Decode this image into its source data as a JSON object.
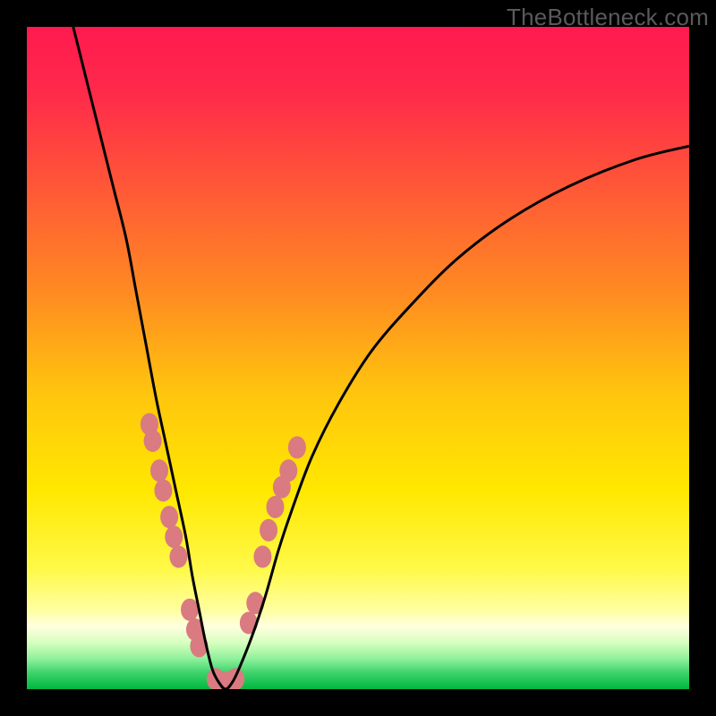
{
  "watermark": "TheBottleneck.com",
  "chart_data": {
    "type": "line",
    "title": "",
    "xlabel": "",
    "ylabel": "",
    "xlim": [
      0,
      100
    ],
    "ylim": [
      0,
      100
    ],
    "grid": false,
    "legend_position": "none",
    "background_gradient": {
      "stops": [
        {
          "offset": 0.0,
          "color": "#ff1a4f"
        },
        {
          "offset": 0.1,
          "color": "#ff2a4a"
        },
        {
          "offset": 0.25,
          "color": "#ff5a36"
        },
        {
          "offset": 0.4,
          "color": "#ff8a22"
        },
        {
          "offset": 0.55,
          "color": "#ffc40e"
        },
        {
          "offset": 0.7,
          "color": "#ffe800"
        },
        {
          "offset": 0.82,
          "color": "#fff94a"
        },
        {
          "offset": 0.88,
          "color": "#ffffa0"
        },
        {
          "offset": 0.905,
          "color": "#ffffe0"
        },
        {
          "offset": 0.93,
          "color": "#d6ffbe"
        },
        {
          "offset": 0.955,
          "color": "#8cf09a"
        },
        {
          "offset": 0.975,
          "color": "#3ed36b"
        },
        {
          "offset": 1.0,
          "color": "#00b840"
        }
      ]
    },
    "series": [
      {
        "name": "bottleneck-curve",
        "x": [
          7,
          9,
          11,
          13,
          15,
          16.5,
          18,
          19.5,
          21,
          22.5,
          24,
          25,
          26,
          27,
          28,
          29,
          30,
          31,
          32,
          34,
          36,
          38,
          40,
          43,
          47,
          52,
          58,
          65,
          73,
          82,
          92,
          100
        ],
        "y": [
          100,
          92,
          84,
          76,
          68,
          60,
          52,
          44,
          37,
          30,
          23,
          17,
          12,
          7,
          3,
          1,
          0,
          1,
          3,
          8,
          14,
          21,
          27,
          35,
          43,
          51,
          58,
          65,
          71,
          76,
          80,
          82
        ],
        "color": "#000000",
        "stroke_width": 2
      }
    ],
    "markers": [
      {
        "name": "left-cluster",
        "color": "#d97b80",
        "r": 10,
        "points": [
          {
            "x": 18.5,
            "y": 40
          },
          {
            "x": 19.0,
            "y": 37.5
          },
          {
            "x": 20.0,
            "y": 33
          },
          {
            "x": 20.6,
            "y": 30
          },
          {
            "x": 21.5,
            "y": 26
          },
          {
            "x": 22.2,
            "y": 23
          },
          {
            "x": 22.9,
            "y": 20
          },
          {
            "x": 24.6,
            "y": 12
          },
          {
            "x": 25.4,
            "y": 9
          },
          {
            "x": 26.0,
            "y": 6.5
          }
        ]
      },
      {
        "name": "valley-cluster",
        "color": "#d97b80",
        "r": 10,
        "points": [
          {
            "x": 28.5,
            "y": 1.5
          },
          {
            "x": 29.5,
            "y": 1.0
          },
          {
            "x": 30.5,
            "y": 1.0
          },
          {
            "x": 31.5,
            "y": 1.5
          }
        ]
      },
      {
        "name": "right-cluster",
        "color": "#d97b80",
        "r": 10,
        "points": [
          {
            "x": 33.5,
            "y": 10
          },
          {
            "x": 34.5,
            "y": 13
          },
          {
            "x": 35.6,
            "y": 20
          },
          {
            "x": 36.5,
            "y": 24
          },
          {
            "x": 37.5,
            "y": 27.5
          },
          {
            "x": 38.5,
            "y": 30.5
          },
          {
            "x": 39.5,
            "y": 33
          },
          {
            "x": 40.8,
            "y": 36.5
          }
        ]
      }
    ]
  },
  "colors": {
    "frame": "#000000",
    "curve": "#000000",
    "marker_fill": "#d97b80",
    "watermark": "#5a5a5a"
  }
}
